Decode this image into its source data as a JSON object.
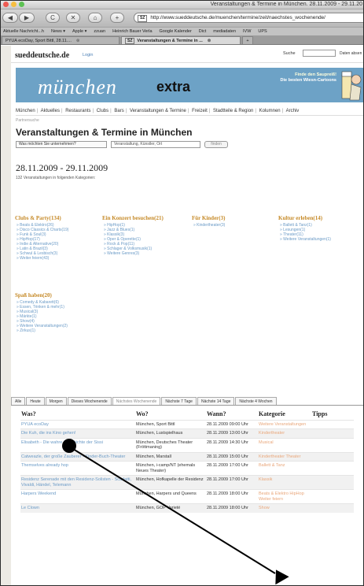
{
  "window": {
    "title": "Veranstaltungen & Termine in München. 28.11.2009 - 29.11.20",
    "url": "http://www.sueddeutsche.de/muenchen/termine/zeit/naechstes_wochenende/",
    "url_badge": "SZ",
    "colors": {
      "close": "#ee5a52",
      "minimize": "#f6be41",
      "zoom": "#5dc253"
    }
  },
  "toolbar": {
    "back_icon": "◀",
    "forward_icon": "▶",
    "reload_icon": "C",
    "stop_icon": "✕",
    "home_icon": "⌂",
    "plus_icon": "+"
  },
  "bookmarks": [
    "Aktuelle Nachricht...h",
    "News ▾",
    "Apple ▾",
    "zzuan",
    "Heinrich Bauer Verla",
    "Google Kalender",
    "Dict",
    "mediadaten",
    "IVW",
    "UPS"
  ],
  "tabs": [
    {
      "label": "PYUA ecoDay, Sport Bittl, 28.11....",
      "close": "⊗",
      "active": false
    },
    {
      "label": "Veranstaltungen & Termine in ...",
      "close": "⊗",
      "badge": "SZ",
      "active": true
    }
  ],
  "site": {
    "logo": "sueddeutsche.de",
    "login": "Login",
    "search_label": "Suche",
    "search_archive": "Daten absen"
  },
  "banner": {
    "title": "münchen",
    "extra": "extra",
    "promo_line1": "Finde den Saupreiß!",
    "promo_line2": "Die besten Wiesn-Cartoons"
  },
  "mainnav": [
    "München",
    "Aktuelles",
    "Restaurants",
    "Clubs",
    "Bars",
    "Veranstaltungen & Termine",
    "Freizeit",
    "Stadtteile & Region",
    "Kolumnen",
    "Archiv"
  ],
  "breadcrumb": "Partnersuche",
  "page_title": "Veranstaltungen & Termine in München",
  "search": {
    "select_value": "Was möchten Sie unternehmen?",
    "input_placeholder": "Veranstaltung, Künstler, Ort",
    "button": "finden"
  },
  "daterange": "28.11.2009 - 29.11.2009",
  "count_text": "132 Veranstaltungen in folgenden Kategorien:",
  "categories": [
    {
      "title": "Clubs & Party(134)",
      "items": [
        "Beats & Elektro(26)",
        "Disco Classics & Charts(19)",
        "Funk & Soul(3)",
        "HipHop(17)",
        "Indie & Alternative(20)",
        "Latin & Brazil(3)",
        "Schwul & Lesbisch(3)",
        "Weiter feiern(43)"
      ]
    },
    {
      "title": "Ein Konzert besuchen(21)",
      "items": [
        "HipHop(1)",
        "Jazz & Blues(1)",
        "Klassik(3)",
        "Oper & Operette(1)",
        "Rock & Pop(11)",
        "Schlager & Volksmusik(1)",
        "Weitere Genres(3)"
      ]
    },
    {
      "title": "Für Kinder(3)",
      "items": [
        "Kindertheater(3)"
      ]
    },
    {
      "title": "Kultur erleben(14)",
      "items": [
        "Ballett & Tanz(1)",
        "Lesungen(1)",
        "Theater(11)",
        "Weitere Veranstaltungen(1)"
      ]
    },
    {
      "title": "Spaß haben(20)",
      "items": [
        "Comedy & Kabarett(6)",
        "Essen, Trinken & mehr(1)",
        "Musical(3)",
        "Märkte(1)",
        "Show(4)",
        "Weitere Veranstaltungen(2)",
        "Zirkus(1)"
      ]
    }
  ],
  "filter_tabs": [
    "Alle",
    "Heute",
    "Morgen",
    "Dieses Wochenende",
    "Nächstes Wochenende",
    "Nächste 7 Tage",
    "Nächste 14 Tage",
    "Nächste 4 Wochen"
  ],
  "table": {
    "headers": [
      "Was?",
      "Wo?",
      "Wann?",
      "Kategorie",
      "Tipps"
    ],
    "rows": [
      {
        "was": "PYUA ecoDay",
        "wo": "München, Sport Bittl",
        "wann": "28.11.2009 09:00 Uhr",
        "kat": "Weitere Veranstaltungen"
      },
      {
        "was": "Die Kuh, die ins Kino gehen!",
        "wo": "München, Lustspielhaus",
        "wann": "28.11.2009 13:00 Uhr",
        "kat": "Kindertheater"
      },
      {
        "was": "Elisabeth - Die wahre Geschichte der Sissi",
        "wo": "München, Deutsches Theater (Fröttmaning)",
        "wann": "28.11.2009 14:30 Uhr",
        "kat": "Musical"
      },
      {
        "was": "Catweazle, der große Zauberer - Kinder-Buch-Theater",
        "wo": "München, Marstall",
        "wann": "28.11.2009 15:00 Uhr",
        "kat": "Kindertheater Theater"
      },
      {
        "was": "Themselves already hop",
        "wo": "München, i-camp/NT (ehemals Neues Theater)",
        "wann": "28.11.2009 17:00 Uhr",
        "kat": "Ballett & Tanz"
      },
      {
        "was": "Residenz Serenade mit den Residenz-Solisten - Scarlatti, Vivaldi, Händel, Telemann",
        "wo": "München, Hofkapelle der Residenz",
        "wann": "28.11.2009 17:00 Uhr",
        "kat": "Klassik"
      },
      {
        "was": "Harpers Weekend",
        "wo": "München, Harpers und Queens",
        "wann": "28.11.2009 18:00 Uhr",
        "kat": "Beats & Elektro HipHop Weiter feiern"
      },
      {
        "was": "Le Clown",
        "wo": "München, GOP Varieté",
        "wann": "28.11.2009 18:00 Uhr",
        "kat": "Show"
      }
    ]
  }
}
